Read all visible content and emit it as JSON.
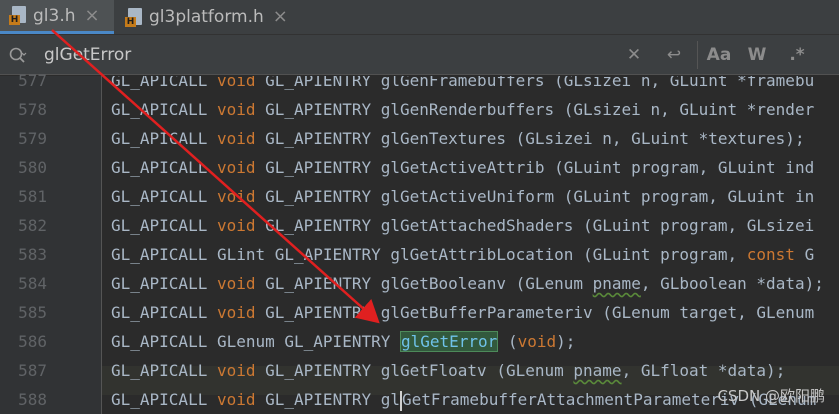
{
  "tabs": [
    {
      "label": "gl3.h",
      "icon": "c-header-file-icon",
      "active": true,
      "close": "×"
    },
    {
      "label": "gl3platform.h",
      "icon": "c-header-file-icon",
      "active": false,
      "close": "×"
    }
  ],
  "search": {
    "value": "glGetError",
    "clear_glyph": "✕",
    "newline_glyph": "↩",
    "match_case": "Aa",
    "whole_words": "W",
    "regex": ".*"
  },
  "editor": {
    "current_line": 588,
    "lines": [
      {
        "no": "577",
        "parts": [
          {
            "t": "GL_APICALL "
          },
          {
            "t": "void",
            "c": "kw"
          },
          {
            "t": " GL_APIENTRY glGenFramebuffers (GLsizei n, GLuint *framebu"
          }
        ]
      },
      {
        "no": "578",
        "parts": [
          {
            "t": "GL_APICALL "
          },
          {
            "t": "void",
            "c": "kw"
          },
          {
            "t": " GL_APIENTRY glGenRenderbuffers (GLsizei n, GLuint *render"
          }
        ]
      },
      {
        "no": "579",
        "parts": [
          {
            "t": "GL_APICALL "
          },
          {
            "t": "void",
            "c": "kw"
          },
          {
            "t": " GL_APIENTRY glGenTextures (GLsizei n, GLuint *textures);"
          }
        ]
      },
      {
        "no": "580",
        "parts": [
          {
            "t": "GL_APICALL "
          },
          {
            "t": "void",
            "c": "kw"
          },
          {
            "t": " GL_APIENTRY glGetActiveAttrib (GLuint program, GLuint ind"
          }
        ]
      },
      {
        "no": "581",
        "parts": [
          {
            "t": "GL_APICALL "
          },
          {
            "t": "void",
            "c": "kw"
          },
          {
            "t": " GL_APIENTRY glGetActiveUniform (GLuint program, GLuint in"
          }
        ]
      },
      {
        "no": "582",
        "parts": [
          {
            "t": "GL_APICALL "
          },
          {
            "t": "void",
            "c": "kw"
          },
          {
            "t": " GL_APIENTRY glGetAttachedShaders (GLuint program, GLsizei"
          }
        ]
      },
      {
        "no": "583",
        "parts": [
          {
            "t": "GL_APICALL GLint GL_APIENTRY glGetAttribLocation (GLuint program, "
          },
          {
            "t": "const",
            "c": "kw"
          },
          {
            "t": " G"
          }
        ]
      },
      {
        "no": "584",
        "parts": [
          {
            "t": "GL_APICALL "
          },
          {
            "t": "void",
            "c": "kw"
          },
          {
            "t": " GL_APIENTRY glGetBooleanv (GLenum "
          },
          {
            "t": "pname",
            "c": "sq"
          },
          {
            "t": ", GLboolean *data);"
          }
        ]
      },
      {
        "no": "585",
        "parts": [
          {
            "t": "GL_APICALL "
          },
          {
            "t": "void",
            "c": "kw"
          },
          {
            "t": " GL_APIENTRY glGetBufferParameteriv (GLenum target, GLenum"
          }
        ]
      },
      {
        "no": "586",
        "parts": [
          {
            "t": "GL_APICALL GLenum GL_APIENTRY "
          },
          {
            "t": "glGetError",
            "c": "match"
          },
          {
            "t": " ("
          },
          {
            "t": "void",
            "c": "kw"
          },
          {
            "t": ");"
          }
        ]
      },
      {
        "no": "587",
        "parts": [
          {
            "t": "GL_APICALL "
          },
          {
            "t": "void",
            "c": "kw"
          },
          {
            "t": " GL_APIENTRY glGetFloatv (GLenum "
          },
          {
            "t": "pname",
            "c": "sq"
          },
          {
            "t": ", GLfloat *data);"
          }
        ]
      },
      {
        "no": "588",
        "parts": [
          {
            "t": "GL_APICALL "
          },
          {
            "t": "void",
            "c": "kw"
          },
          {
            "t": " GL_APIENTRY gl"
          },
          {
            "t": "caret",
            "c": "caret"
          },
          {
            "t": "GetFramebufferAttachmentParameteriv (GLenum"
          }
        ]
      }
    ]
  },
  "watermark": "CSDN @欧阳鹏",
  "colors": {
    "keyword": "#cc7832",
    "match_bg": "#32593d",
    "annotation_arrow": "#e02020"
  }
}
